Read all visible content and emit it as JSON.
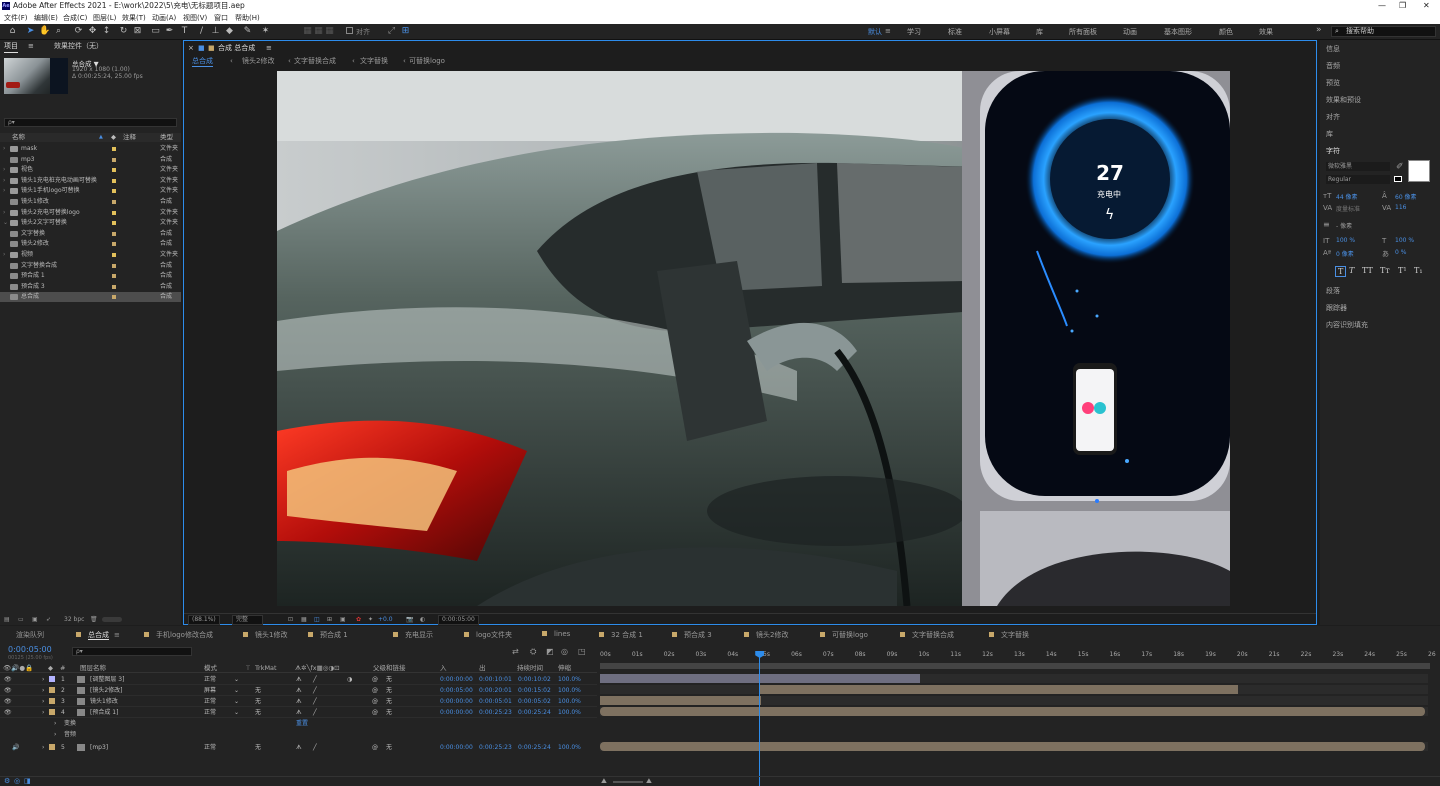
{
  "app": {
    "title": "Adobe After Effects 2021 - E:\\work\\2022\\5\\充电\\无标题项目.aep",
    "menus": [
      "文件(F)",
      "编辑(E)",
      "合成(C)",
      "图层(L)",
      "效果(T)",
      "动画(A)",
      "视图(V)",
      "窗口",
      "帮助(H)"
    ]
  },
  "toolbar": {
    "align_label": "对齐",
    "workspaces": [
      "默认",
      "≡",
      "学习",
      "标准",
      "小屏幕",
      "库",
      "所有面板",
      "动画",
      "基本图形",
      "颜色",
      "效果"
    ],
    "more": "»",
    "search_placeholder": "搜索帮助"
  },
  "project": {
    "tab_project": "项目",
    "tab_effects": "效果控件（无）",
    "thumb_name": "总合成 ▼",
    "thumb_info1": "1920 x 1080 (1.00)",
    "thumb_info2": "Δ 0:00:25:24, 25.00 fps",
    "search_placeholder": "ρ▾",
    "columns": {
      "name": "名称",
      "comment": "注释",
      "type": "类型"
    },
    "items": [
      {
        "name": "mask",
        "type": "文件夹",
        "kind": "folder",
        "twirl": "›"
      },
      {
        "name": "mp3",
        "type": "合成",
        "kind": "comp",
        "twirl": ""
      },
      {
        "name": "视色",
        "type": "文件夹",
        "kind": "folder",
        "twirl": "›"
      },
      {
        "name": "镜头1充电桩充电动画可替换",
        "type": "文件夹",
        "kind": "folder",
        "twirl": "›"
      },
      {
        "name": "镜头1手机logo可替换",
        "type": "文件夹",
        "kind": "folder",
        "twirl": "›"
      },
      {
        "name": "镜头1修改",
        "type": "合成",
        "kind": "comp",
        "twirl": ""
      },
      {
        "name": "镜头2充电可替换logo",
        "type": "文件夹",
        "kind": "folder",
        "twirl": "›"
      },
      {
        "name": "镜头2文字可替换",
        "type": "文件夹",
        "kind": "folder",
        "twirl": "⌄"
      },
      {
        "name": "文字替换",
        "type": "合成",
        "kind": "comp",
        "twirl": ""
      },
      {
        "name": "镜头2修改",
        "type": "合成",
        "kind": "comp",
        "twirl": ""
      },
      {
        "name": "视频",
        "type": "文件夹",
        "kind": "folder",
        "twirl": "›"
      },
      {
        "name": "文字替换合成",
        "type": "合成",
        "kind": "comp",
        "twirl": ""
      },
      {
        "name": "预合成 1",
        "type": "合成",
        "kind": "comp",
        "twirl": ""
      },
      {
        "name": "预合成 3",
        "type": "合成",
        "kind": "comp",
        "twirl": ""
      },
      {
        "name": "总合成",
        "type": "合成",
        "kind": "comp",
        "twirl": ""
      }
    ],
    "bpc": "32 bpc"
  },
  "composition": {
    "tab_label": "合成 总合成",
    "breadcrumbs": [
      "总合成",
      "镜头2修改",
      "文字替换合成",
      "文字替换",
      "可替换logo"
    ],
    "zoom": "(88.1%)",
    "quality": "完整",
    "exposure": "+0.0",
    "timecode": "0:00:05:00",
    "overlay": {
      "number": "27",
      "status": "充电中"
    }
  },
  "right_panel": {
    "items": [
      "信息",
      "音频",
      "预览",
      "效果和预设",
      "对齐",
      "库",
      "字符"
    ],
    "font_family": "微软雅黑",
    "font_style": "Regular",
    "font_size": "44 像素",
    "leading": "60 像素",
    "kerning": "度量标准",
    "tracking": "116",
    "stroke": "- 像素",
    "vscale": "100 %",
    "hscale": "100 %",
    "baseline": "0 像素",
    "tsume": "0 %",
    "styles": [
      "T",
      "T",
      "TT",
      "Tт",
      "T¹",
      "T₁"
    ],
    "bottom_items": [
      "段落",
      "跟踪器",
      "内容识别填充"
    ]
  },
  "timeline": {
    "tabs": [
      "渲染队列",
      "总合成",
      "手机logo修改合成",
      "镜头1修改",
      "预合成 1",
      "充电显示",
      "logo文件夹",
      "lines",
      "32 合成 1",
      "预合成 3",
      "镜头2修改",
      "可替换logo",
      "文字替换合成",
      "文字替换"
    ],
    "current_time": "0:00:05:00",
    "frame_info": "00125 (25.00 fps)",
    "search_placeholder": "ρ▾",
    "headers": {
      "layer_name": "图层名称",
      "mode": "模式",
      "trkmat": "TrkMat",
      "parent": "父级和链接",
      "in": "入",
      "out": "出",
      "duration": "持续时间",
      "stretch": "伸缩"
    },
    "layers": [
      {
        "num": "1",
        "name": "[调整图层 3]",
        "mode": "正常",
        "trk": "",
        "parent": "无",
        "in": "0:00:00:00",
        "out": "0:00:10:01",
        "dur": "0:00:10:02",
        "stretch": "100.0%",
        "color": "#b3b3ff"
      },
      {
        "num": "2",
        "name": "[镜头2修改]",
        "mode": "屏幕",
        "trk": "无",
        "parent": "无",
        "in": "0:00:05:00",
        "out": "0:00:20:01",
        "dur": "0:00:15:02",
        "stretch": "100.0%",
        "color": "#c8a86a"
      },
      {
        "num": "3",
        "name": "镜头1修改",
        "mode": "正常",
        "trk": "无",
        "parent": "无",
        "in": "0:00:00:00",
        "out": "0:00:05:01",
        "dur": "0:00:05:02",
        "stretch": "100.0%",
        "color": "#c8a86a"
      },
      {
        "num": "4",
        "name": "[预合成 1]",
        "mode": "正常",
        "trk": "无",
        "parent": "无",
        "in": "0:00:00:00",
        "out": "0:00:25:23",
        "dur": "0:00:25:24",
        "stretch": "100.0%",
        "color": "#c8a86a"
      }
    ],
    "sub_rows": [
      "变换",
      "音频"
    ],
    "reset_label": "重置",
    "audio_layer": {
      "num": "5",
      "name": "[mp3]",
      "mode": "正常",
      "trk": "无",
      "parent": "无",
      "in": "0:00:00:00",
      "out": "0:00:25:23",
      "dur": "0:00:25:24",
      "stretch": "100.0%"
    },
    "ruler": [
      "00s",
      "01s",
      "02s",
      "03s",
      "04s",
      "05s",
      "06s",
      "07s",
      "08s",
      "09s",
      "10s",
      "11s",
      "12s",
      "13s",
      "14s",
      "15s",
      "16s",
      "17s",
      "18s",
      "19s",
      "20s",
      "21s",
      "22s",
      "23s",
      "24s",
      "25s",
      "26"
    ],
    "playhead_seconds": 5,
    "total_seconds": 26
  },
  "colors": {
    "accent": "#2d8ceb",
    "label_yellow": "#e2c05a",
    "bar_tan": "#7e7160",
    "bar_lav": "#6e6e80"
  }
}
